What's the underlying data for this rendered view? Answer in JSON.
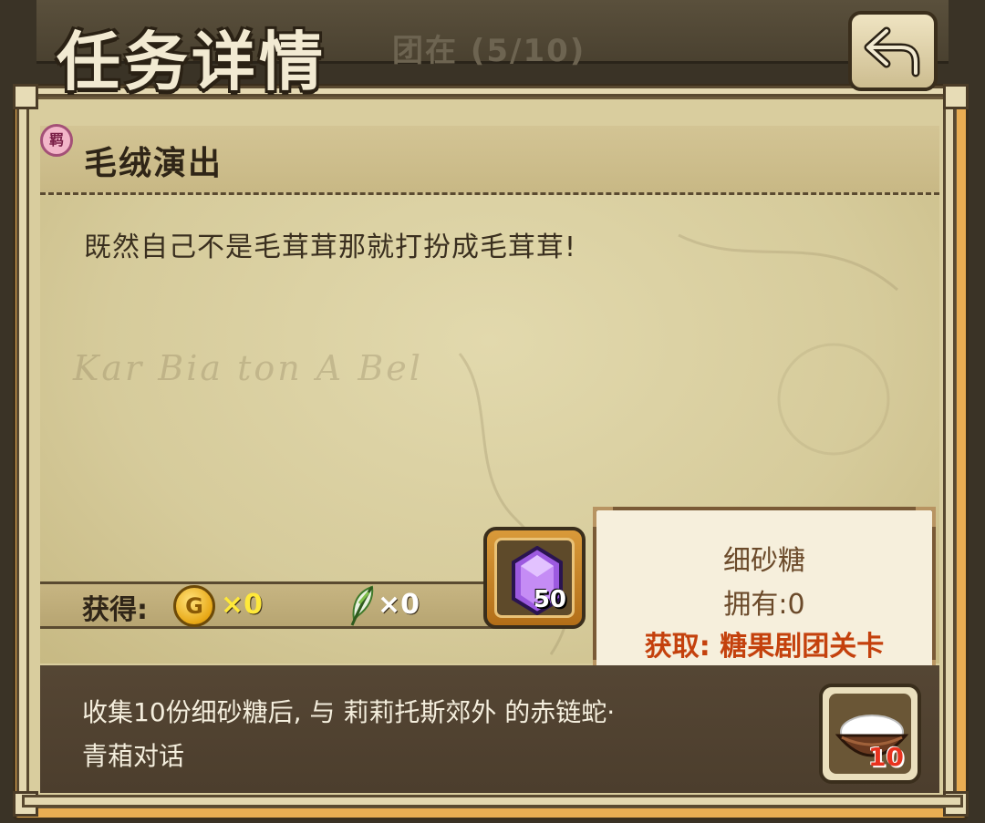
{
  "background": {
    "behind_text": "团在 (5/10)"
  },
  "header": {
    "title": "任务详情",
    "back_icon": "return-arrow-icon"
  },
  "quest": {
    "badge": "羁",
    "name": "毛绒演出",
    "description": "既然自己不是毛茸茸那就打扮成毛茸茸!"
  },
  "map_watermark": "Kar Bia ton A Bel",
  "reward": {
    "label": "获得:",
    "gold_icon": "gold-coin-icon",
    "gold_letter": "G",
    "gold_count": "×0",
    "feather_icon": "feather-icon",
    "feather_count": "×0",
    "gem_icon": "purple-gem-icon",
    "gem_count": "50"
  },
  "tooltip": {
    "name": "细砂糖",
    "owned": "拥有:0",
    "source": "获取: 糖果剧团关卡"
  },
  "objective": {
    "text_line1": "收集10份细砂糖后, 与 莉莉托斯郊外 的赤链蛇·",
    "text_line2": "青葙对话",
    "item_icon": "sugar-bowl-icon",
    "item_count": "10"
  },
  "colors": {
    "frame_orange": "#e9ad52",
    "parchment": "#d9cd9e",
    "gold_text": "#ffe93a",
    "source_text": "#c4410d",
    "count_red": "#e8321e"
  }
}
